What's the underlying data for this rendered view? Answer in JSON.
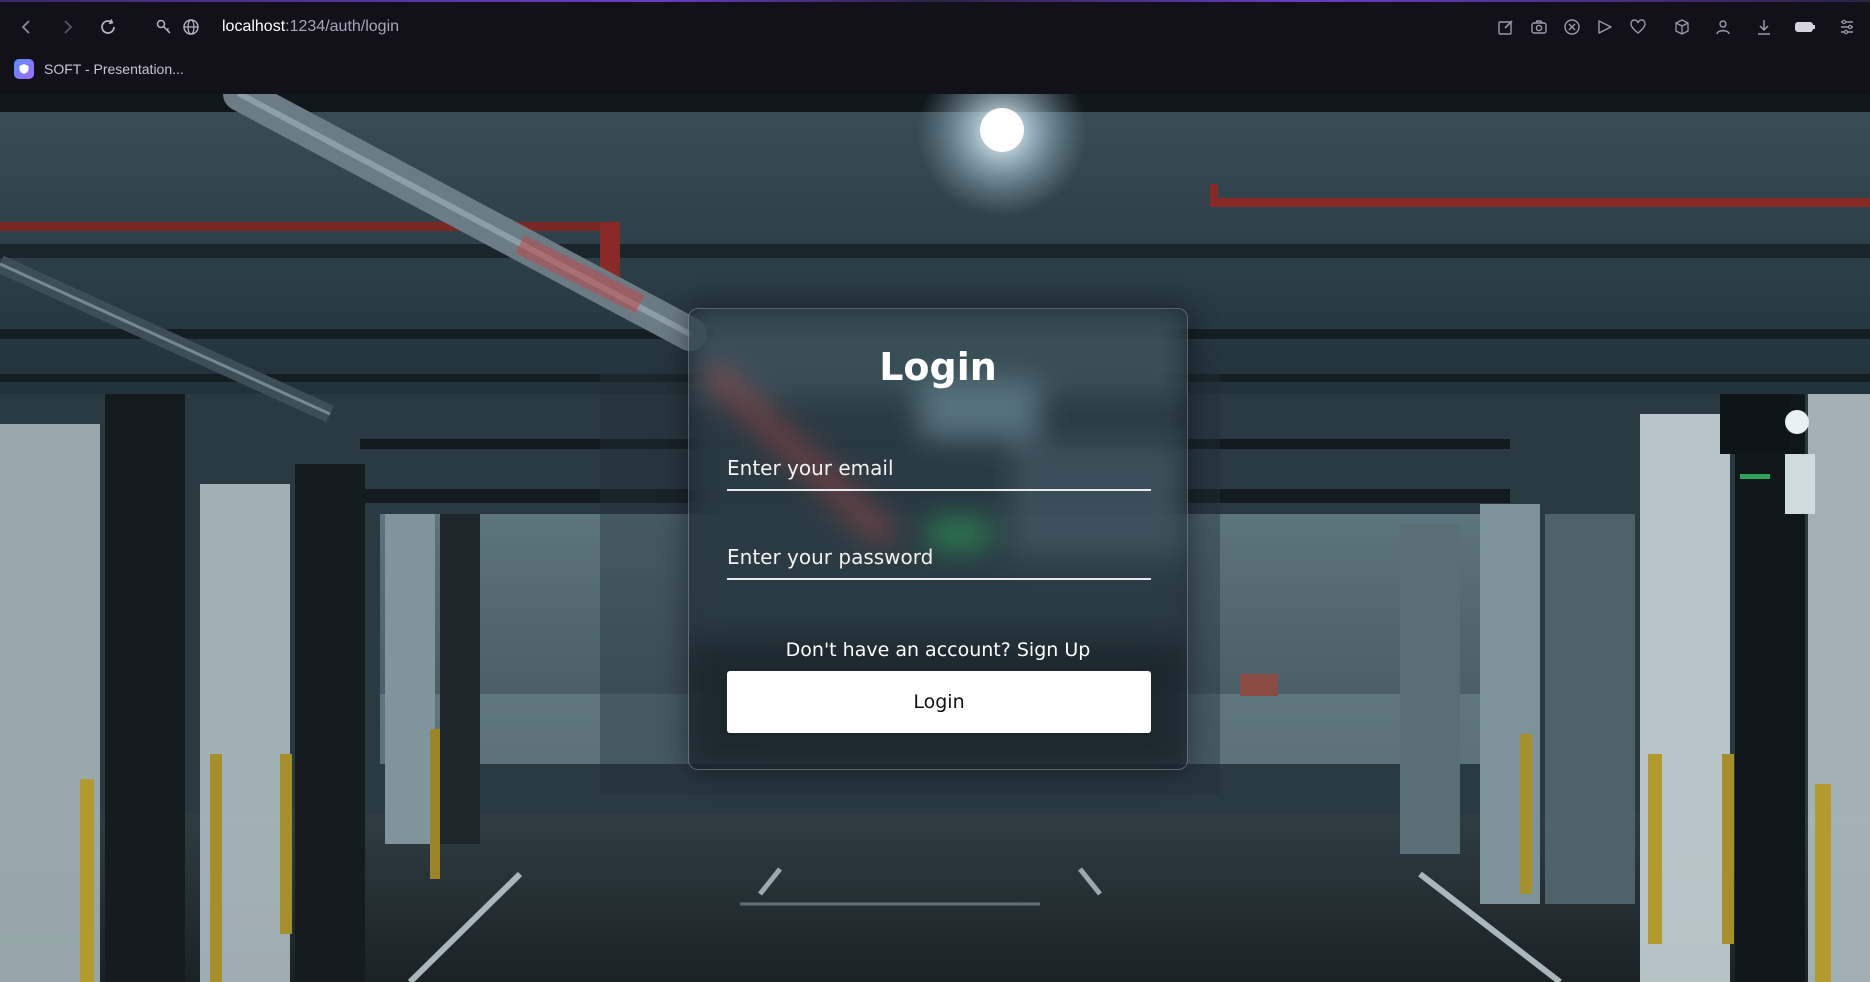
{
  "browser": {
    "url_host": "localhost",
    "url_path": ":1234/auth/login",
    "bookmark_label": "SOFT - Presentation..."
  },
  "login": {
    "title": "Login",
    "email_placeholder": "Enter your email",
    "password_placeholder": "Enter your password",
    "signup_prompt": "Don't have an account?",
    "signup_link": "Sign Up",
    "submit_label": "Login"
  },
  "icons": {
    "left": [
      "back-icon",
      "forward-icon",
      "reload-icon",
      "site-settings-icon",
      "globe-icon"
    ],
    "right": [
      "screenshot-edit-icon",
      "camera-icon",
      "close-circle-icon",
      "send-icon",
      "heart-icon",
      "box-icon",
      "profile-icon",
      "download-icon",
      "battery-icon",
      "menu-icon"
    ]
  },
  "colors": {
    "chrome_bg": "#121019",
    "accent": "#6b3cc9",
    "button_bg": "#ffffff",
    "button_text": "#111111"
  }
}
